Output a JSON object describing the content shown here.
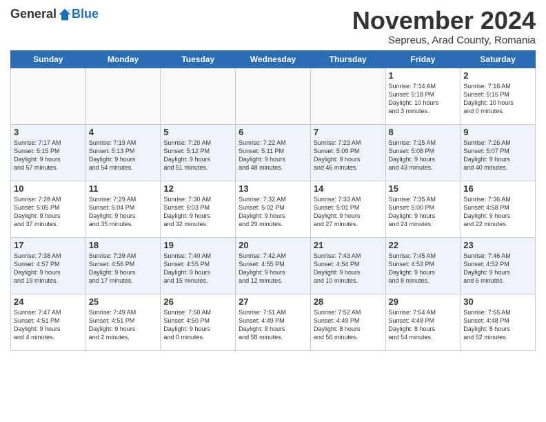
{
  "header": {
    "logo_general": "General",
    "logo_blue": "Blue",
    "month_title": "November 2024",
    "location": "Sepreus, Arad County, Romania"
  },
  "days_of_week": [
    "Sunday",
    "Monday",
    "Tuesday",
    "Wednesday",
    "Thursday",
    "Friday",
    "Saturday"
  ],
  "weeks": [
    [
      {
        "day": "",
        "info": ""
      },
      {
        "day": "",
        "info": ""
      },
      {
        "day": "",
        "info": ""
      },
      {
        "day": "",
        "info": ""
      },
      {
        "day": "",
        "info": ""
      },
      {
        "day": "1",
        "info": "Sunrise: 7:14 AM\nSunset: 5:18 PM\nDaylight: 10 hours\nand 3 minutes."
      },
      {
        "day": "2",
        "info": "Sunrise: 7:16 AM\nSunset: 5:16 PM\nDaylight: 10 hours\nand 0 minutes."
      }
    ],
    [
      {
        "day": "3",
        "info": "Sunrise: 7:17 AM\nSunset: 5:15 PM\nDaylight: 9 hours\nand 57 minutes."
      },
      {
        "day": "4",
        "info": "Sunrise: 7:19 AM\nSunset: 5:13 PM\nDaylight: 9 hours\nand 54 minutes."
      },
      {
        "day": "5",
        "info": "Sunrise: 7:20 AM\nSunset: 5:12 PM\nDaylight: 9 hours\nand 51 minutes."
      },
      {
        "day": "6",
        "info": "Sunrise: 7:22 AM\nSunset: 5:11 PM\nDaylight: 9 hours\nand 48 minutes."
      },
      {
        "day": "7",
        "info": "Sunrise: 7:23 AM\nSunset: 5:09 PM\nDaylight: 9 hours\nand 46 minutes."
      },
      {
        "day": "8",
        "info": "Sunrise: 7:25 AM\nSunset: 5:08 PM\nDaylight: 9 hours\nand 43 minutes."
      },
      {
        "day": "9",
        "info": "Sunrise: 7:26 AM\nSunset: 5:07 PM\nDaylight: 9 hours\nand 40 minutes."
      }
    ],
    [
      {
        "day": "10",
        "info": "Sunrise: 7:28 AM\nSunset: 5:05 PM\nDaylight: 9 hours\nand 37 minutes."
      },
      {
        "day": "11",
        "info": "Sunrise: 7:29 AM\nSunset: 5:04 PM\nDaylight: 9 hours\nand 35 minutes."
      },
      {
        "day": "12",
        "info": "Sunrise: 7:30 AM\nSunset: 5:03 PM\nDaylight: 9 hours\nand 32 minutes."
      },
      {
        "day": "13",
        "info": "Sunrise: 7:32 AM\nSunset: 5:02 PM\nDaylight: 9 hours\nand 29 minutes."
      },
      {
        "day": "14",
        "info": "Sunrise: 7:33 AM\nSunset: 5:01 PM\nDaylight: 9 hours\nand 27 minutes."
      },
      {
        "day": "15",
        "info": "Sunrise: 7:35 AM\nSunset: 5:00 PM\nDaylight: 9 hours\nand 24 minutes."
      },
      {
        "day": "16",
        "info": "Sunrise: 7:36 AM\nSunset: 4:58 PM\nDaylight: 9 hours\nand 22 minutes."
      }
    ],
    [
      {
        "day": "17",
        "info": "Sunrise: 7:38 AM\nSunset: 4:57 PM\nDaylight: 9 hours\nand 19 minutes."
      },
      {
        "day": "18",
        "info": "Sunrise: 7:39 AM\nSunset: 4:56 PM\nDaylight: 9 hours\nand 17 minutes."
      },
      {
        "day": "19",
        "info": "Sunrise: 7:40 AM\nSunset: 4:55 PM\nDaylight: 9 hours\nand 15 minutes."
      },
      {
        "day": "20",
        "info": "Sunrise: 7:42 AM\nSunset: 4:55 PM\nDaylight: 9 hours\nand 12 minutes."
      },
      {
        "day": "21",
        "info": "Sunrise: 7:43 AM\nSunset: 4:54 PM\nDaylight: 9 hours\nand 10 minutes."
      },
      {
        "day": "22",
        "info": "Sunrise: 7:45 AM\nSunset: 4:53 PM\nDaylight: 9 hours\nand 8 minutes."
      },
      {
        "day": "23",
        "info": "Sunrise: 7:46 AM\nSunset: 4:52 PM\nDaylight: 9 hours\nand 6 minutes."
      }
    ],
    [
      {
        "day": "24",
        "info": "Sunrise: 7:47 AM\nSunset: 4:51 PM\nDaylight: 9 hours\nand 4 minutes."
      },
      {
        "day": "25",
        "info": "Sunrise: 7:49 AM\nSunset: 4:51 PM\nDaylight: 9 hours\nand 2 minutes."
      },
      {
        "day": "26",
        "info": "Sunrise: 7:50 AM\nSunset: 4:50 PM\nDaylight: 9 hours\nand 0 minutes."
      },
      {
        "day": "27",
        "info": "Sunrise: 7:51 AM\nSunset: 4:49 PM\nDaylight: 8 hours\nand 58 minutes."
      },
      {
        "day": "28",
        "info": "Sunrise: 7:52 AM\nSunset: 4:49 PM\nDaylight: 8 hours\nand 56 minutes."
      },
      {
        "day": "29",
        "info": "Sunrise: 7:54 AM\nSunset: 4:48 PM\nDaylight: 8 hours\nand 54 minutes."
      },
      {
        "day": "30",
        "info": "Sunrise: 7:55 AM\nSunset: 4:48 PM\nDaylight: 8 hours\nand 52 minutes."
      }
    ]
  ]
}
